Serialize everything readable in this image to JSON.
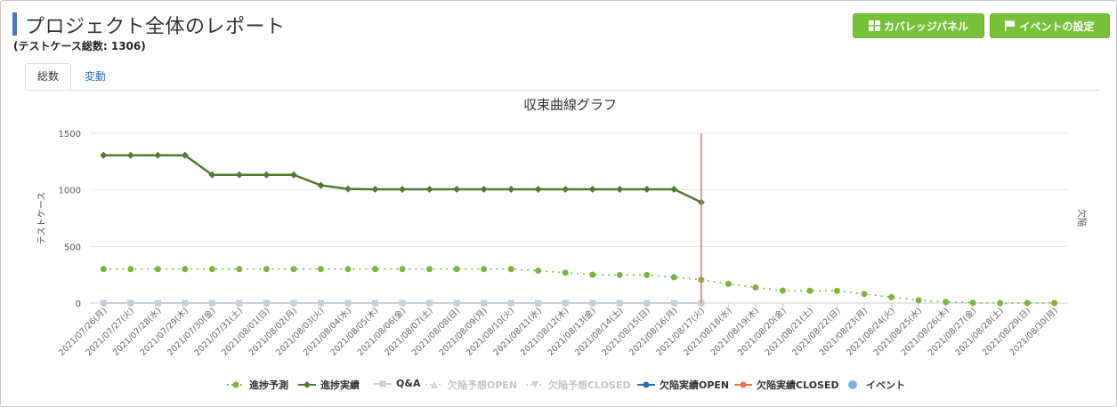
{
  "header": {
    "title": "プロジェクト全体のレポート",
    "subtitle": "(テストケース総数: 1306)"
  },
  "buttons": {
    "coverage_label": "カバレッジパネル",
    "event_label": "イベントの設定"
  },
  "tabs": [
    {
      "label": "総数",
      "active": true
    },
    {
      "label": "変動",
      "active": false
    }
  ],
  "colors": {
    "forecast": "#7cb342",
    "actual": "#4f7a2f",
    "qa": "#c9ced6",
    "defect_open": "#2b6cb0",
    "defect_closed": "#e8734a",
    "event": "#7ab0e8",
    "today_line": "#e57373",
    "button": "#77c13a"
  },
  "chart_data": {
    "type": "line",
    "title": "収束曲線グラフ",
    "ylabel": "テストケース",
    "y2label": "欠陥",
    "ylim": [
      0,
      1500
    ],
    "yticks": [
      "0",
      "500",
      "1000",
      "1500"
    ],
    "categories": [
      "2021/07/26(月)",
      "2021/07/27(火)",
      "2021/07/28(水)",
      "2021/07/29(木)",
      "2021/07/30(金)",
      "2021/07/31(土)",
      "2021/08/01(日)",
      "2021/08/02(月)",
      "2021/08/03(火)",
      "2021/08/04(水)",
      "2021/08/05(木)",
      "2021/08/06(金)",
      "2021/08/07(土)",
      "2021/08/08(日)",
      "2021/08/09(月)",
      "2021/08/10(火)",
      "2021/08/11(水)",
      "2021/08/12(木)",
      "2021/08/13(金)",
      "2021/08/14(土)",
      "2021/08/15(日)",
      "2021/08/16(月)",
      "2021/08/17(火)",
      "2021/08/18(水)",
      "2021/08/19(木)",
      "2021/08/20(金)",
      "2021/08/21(土)",
      "2021/08/22(日)",
      "2021/08/23(月)",
      "2021/08/24(火)",
      "2021/08/25(水)",
      "2021/08/26(木)",
      "2021/08/27(金)",
      "2021/08/28(土)",
      "2021/08/29(日)",
      "2021/08/30(月)"
    ],
    "today_category": "2021/08/17(火)",
    "series": [
      {
        "name": "進捗予測",
        "style": "dotted",
        "marker": "circle",
        "values": [
          300,
          300,
          300,
          300,
          300,
          300,
          300,
          300,
          300,
          300,
          300,
          300,
          300,
          300,
          300,
          300,
          285,
          268,
          250,
          248,
          248,
          228,
          205,
          170,
          138,
          110,
          108,
          108,
          80,
          52,
          25,
          10,
          2,
          0,
          0,
          0
        ]
      },
      {
        "name": "進捗実績",
        "style": "solid",
        "marker": "diamond",
        "values": [
          1306,
          1306,
          1306,
          1306,
          1133,
          1133,
          1133,
          1133,
          1040,
          1008,
          1005,
          1005,
          1005,
          1005,
          1005,
          1005,
          1005,
          1005,
          1005,
          1005,
          1005,
          1005,
          890
        ]
      },
      {
        "name": "Q&A",
        "style": "solid",
        "marker": "square",
        "values": [
          0,
          0,
          0,
          0,
          0,
          0,
          0,
          0,
          0,
          0,
          0,
          0,
          0,
          0,
          0,
          0,
          0,
          0,
          0,
          0,
          0,
          0,
          0
        ]
      },
      {
        "name": "欠陥予想OPEN",
        "style": "dim",
        "marker": "triangle",
        "values": []
      },
      {
        "name": "欠陥予想CLOSED",
        "style": "dim",
        "marker": "triangle-down",
        "values": []
      },
      {
        "name": "欠陥実績OPEN",
        "style": "solid",
        "marker": "circle",
        "values": []
      },
      {
        "name": "欠陥実績CLOSED",
        "style": "solid",
        "marker": "circle",
        "values": []
      },
      {
        "name": "イベント",
        "style": "marker",
        "marker": "circle",
        "values": []
      }
    ],
    "grid": true,
    "legend_position": "bottom"
  }
}
